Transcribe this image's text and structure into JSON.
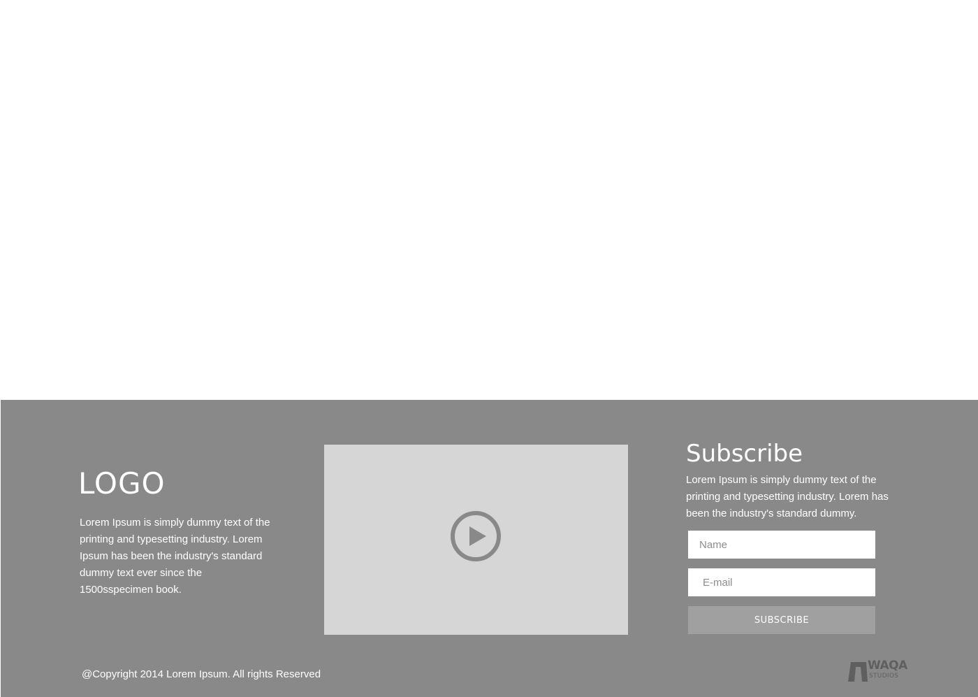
{
  "footer": {
    "logo_text": "LOGO",
    "about_text": "Lorem Ipsum is simply dummy text of the printing and typesetting industry. Lorem Ipsum has been the industry's standard dummy text ever since the 1500sspecimen book.",
    "copyright": "@Copyright 2014 Lorem Ipsum. All rights Reserved",
    "brand": {
      "word": "WAQA",
      "sub": "STUDIOS"
    }
  },
  "video": {
    "play_icon": "play-circle-icon"
  },
  "subscribe": {
    "title": "Subscribe",
    "description": "Lorem Ipsum is simply dummy text of the printing and typesetting industry. Lorem has been the industry's standard dummy.",
    "name_placeholder": "Name",
    "email_placeholder": "E-mail",
    "button_label": "SUBSCRIBE"
  },
  "colors": {
    "footer_bg": "#898989",
    "video_bg": "#d6d6d6",
    "play_icon": "#898989",
    "button_bg": "#a0a0a0",
    "text": "#ffffff"
  }
}
